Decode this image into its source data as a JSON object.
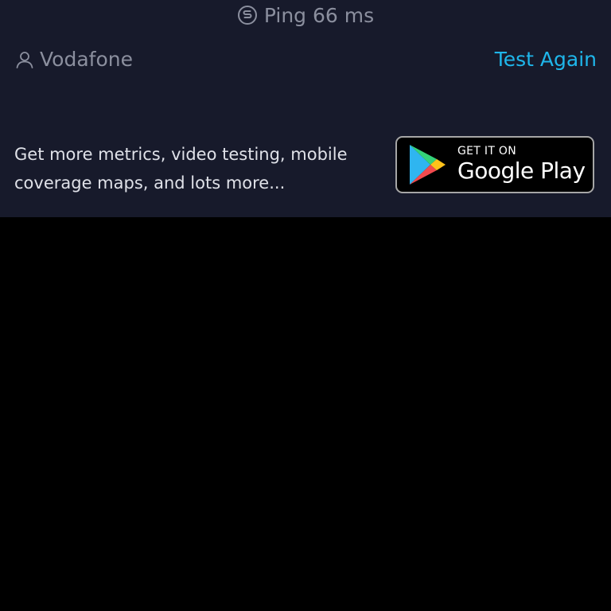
{
  "ping": {
    "label": "Ping 66 ms",
    "icon": "ping-icon"
  },
  "provider": {
    "name": "Vodafone",
    "icon": "user-icon"
  },
  "actions": {
    "test_again_label": "Test Again"
  },
  "promo": {
    "text": "Get more metrics, video testing, mobile coverage maps, and lots more..."
  },
  "google_play": {
    "small_label": "GET IT ON",
    "large_label": "Google Play",
    "icon": "google-play-logo-icon"
  },
  "colors": {
    "panel_bg": "#171a2b",
    "accent": "#1fb6ea",
    "muted_text": "#8b8f9e",
    "body_text": "#dfe1e8"
  }
}
